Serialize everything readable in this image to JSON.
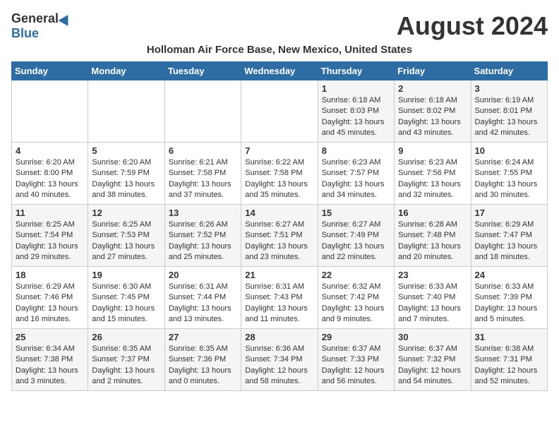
{
  "header": {
    "logo_general": "General",
    "logo_blue": "Blue",
    "month_year": "August 2024",
    "location": "Holloman Air Force Base, New Mexico, United States"
  },
  "weekdays": [
    "Sunday",
    "Monday",
    "Tuesday",
    "Wednesday",
    "Thursday",
    "Friday",
    "Saturday"
  ],
  "weeks": [
    [
      {
        "day": "",
        "info": ""
      },
      {
        "day": "",
        "info": ""
      },
      {
        "day": "",
        "info": ""
      },
      {
        "day": "",
        "info": ""
      },
      {
        "day": "1",
        "info": "Sunrise: 6:18 AM\nSunset: 8:03 PM\nDaylight: 13 hours\nand 45 minutes."
      },
      {
        "day": "2",
        "info": "Sunrise: 6:18 AM\nSunset: 8:02 PM\nDaylight: 13 hours\nand 43 minutes."
      },
      {
        "day": "3",
        "info": "Sunrise: 6:19 AM\nSunset: 8:01 PM\nDaylight: 13 hours\nand 42 minutes."
      }
    ],
    [
      {
        "day": "4",
        "info": "Sunrise: 6:20 AM\nSunset: 8:00 PM\nDaylight: 13 hours\nand 40 minutes."
      },
      {
        "day": "5",
        "info": "Sunrise: 6:20 AM\nSunset: 7:59 PM\nDaylight: 13 hours\nand 38 minutes."
      },
      {
        "day": "6",
        "info": "Sunrise: 6:21 AM\nSunset: 7:58 PM\nDaylight: 13 hours\nand 37 minutes."
      },
      {
        "day": "7",
        "info": "Sunrise: 6:22 AM\nSunset: 7:58 PM\nDaylight: 13 hours\nand 35 minutes."
      },
      {
        "day": "8",
        "info": "Sunrise: 6:23 AM\nSunset: 7:57 PM\nDaylight: 13 hours\nand 34 minutes."
      },
      {
        "day": "9",
        "info": "Sunrise: 6:23 AM\nSunset: 7:56 PM\nDaylight: 13 hours\nand 32 minutes."
      },
      {
        "day": "10",
        "info": "Sunrise: 6:24 AM\nSunset: 7:55 PM\nDaylight: 13 hours\nand 30 minutes."
      }
    ],
    [
      {
        "day": "11",
        "info": "Sunrise: 6:25 AM\nSunset: 7:54 PM\nDaylight: 13 hours\nand 29 minutes."
      },
      {
        "day": "12",
        "info": "Sunrise: 6:25 AM\nSunset: 7:53 PM\nDaylight: 13 hours\nand 27 minutes."
      },
      {
        "day": "13",
        "info": "Sunrise: 6:26 AM\nSunset: 7:52 PM\nDaylight: 13 hours\nand 25 minutes."
      },
      {
        "day": "14",
        "info": "Sunrise: 6:27 AM\nSunset: 7:51 PM\nDaylight: 13 hours\nand 23 minutes."
      },
      {
        "day": "15",
        "info": "Sunrise: 6:27 AM\nSunset: 7:49 PM\nDaylight: 13 hours\nand 22 minutes."
      },
      {
        "day": "16",
        "info": "Sunrise: 6:28 AM\nSunset: 7:48 PM\nDaylight: 13 hours\nand 20 minutes."
      },
      {
        "day": "17",
        "info": "Sunrise: 6:29 AM\nSunset: 7:47 PM\nDaylight: 13 hours\nand 18 minutes."
      }
    ],
    [
      {
        "day": "18",
        "info": "Sunrise: 6:29 AM\nSunset: 7:46 PM\nDaylight: 13 hours\nand 16 minutes."
      },
      {
        "day": "19",
        "info": "Sunrise: 6:30 AM\nSunset: 7:45 PM\nDaylight: 13 hours\nand 15 minutes."
      },
      {
        "day": "20",
        "info": "Sunrise: 6:31 AM\nSunset: 7:44 PM\nDaylight: 13 hours\nand 13 minutes."
      },
      {
        "day": "21",
        "info": "Sunrise: 6:31 AM\nSunset: 7:43 PM\nDaylight: 13 hours\nand 11 minutes."
      },
      {
        "day": "22",
        "info": "Sunrise: 6:32 AM\nSunset: 7:42 PM\nDaylight: 13 hours\nand 9 minutes."
      },
      {
        "day": "23",
        "info": "Sunrise: 6:33 AM\nSunset: 7:40 PM\nDaylight: 13 hours\nand 7 minutes."
      },
      {
        "day": "24",
        "info": "Sunrise: 6:33 AM\nSunset: 7:39 PM\nDaylight: 13 hours\nand 5 minutes."
      }
    ],
    [
      {
        "day": "25",
        "info": "Sunrise: 6:34 AM\nSunset: 7:38 PM\nDaylight: 13 hours\nand 3 minutes."
      },
      {
        "day": "26",
        "info": "Sunrise: 6:35 AM\nSunset: 7:37 PM\nDaylight: 13 hours\nand 2 minutes."
      },
      {
        "day": "27",
        "info": "Sunrise: 6:35 AM\nSunset: 7:36 PM\nDaylight: 13 hours\nand 0 minutes."
      },
      {
        "day": "28",
        "info": "Sunrise: 6:36 AM\nSunset: 7:34 PM\nDaylight: 12 hours\nand 58 minutes."
      },
      {
        "day": "29",
        "info": "Sunrise: 6:37 AM\nSunset: 7:33 PM\nDaylight: 12 hours\nand 56 minutes."
      },
      {
        "day": "30",
        "info": "Sunrise: 6:37 AM\nSunset: 7:32 PM\nDaylight: 12 hours\nand 54 minutes."
      },
      {
        "day": "31",
        "info": "Sunrise: 6:38 AM\nSunset: 7:31 PM\nDaylight: 12 hours\nand 52 minutes."
      }
    ]
  ]
}
